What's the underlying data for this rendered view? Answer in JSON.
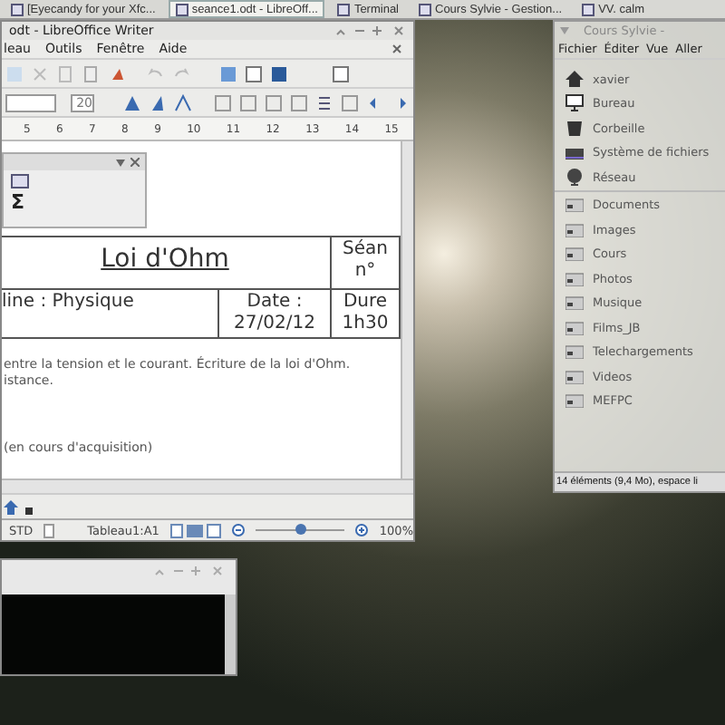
{
  "taskbar": {
    "tasks": [
      {
        "label": "[Eyecandy for your Xfc...",
        "selected": false
      },
      {
        "label": "seance1.odt - LibreOff...",
        "selected": true
      },
      {
        "label": "Terminal",
        "selected": false
      },
      {
        "label": "Cours Sylvie - Gestion...",
        "selected": false
      },
      {
        "label": "VV. calm",
        "selected": false
      }
    ]
  },
  "writer": {
    "title": "odt - LibreOffice Writer",
    "menu": [
      "leau",
      "Outils",
      "Fenêtre",
      "Aide"
    ],
    "font_size": "20",
    "ruler": [
      "5",
      "6",
      "7",
      "8",
      "9",
      "10",
      "11",
      "12",
      "13",
      "14",
      "15"
    ],
    "formula_button": "Σ",
    "table": {
      "title": "Loi d'Ohm",
      "session": [
        "Séan",
        "n°"
      ],
      "subject": "line : Physique",
      "date_label": "Date :",
      "date": "27/02/12",
      "duration_label": "Dure",
      "duration": "1h30"
    },
    "paragraphs": [
      "entre la tension et le courant. Écriture de la loi d'Ohm.",
      "istance."
    ],
    "note": "(en cours d'acquisition)",
    "status": {
      "mode": "STD",
      "cell": "Tableau1:A1",
      "zoom": "100%"
    },
    "zoom_slider": {
      "level": 0.5
    }
  },
  "file_manager": {
    "title": "Cours Sylvie -",
    "menu": [
      "Fichier",
      "Éditer",
      "Vue",
      "Aller"
    ],
    "places": [
      {
        "label": "xavier",
        "kind": "home"
      },
      {
        "label": "Bureau",
        "kind": "desktop"
      },
      {
        "label": "Corbeille",
        "kind": "trash"
      },
      {
        "label": "Système de fichiers",
        "kind": "drive"
      },
      {
        "label": "Réseau",
        "kind": "network"
      }
    ],
    "folders": [
      "Documents",
      "Images",
      "Cours",
      "Photos",
      "Musique",
      "Films_JB",
      "Telechargements",
      "Videos",
      "MEFPC"
    ],
    "status": "14 éléments (9,4 Mo), espace li"
  }
}
